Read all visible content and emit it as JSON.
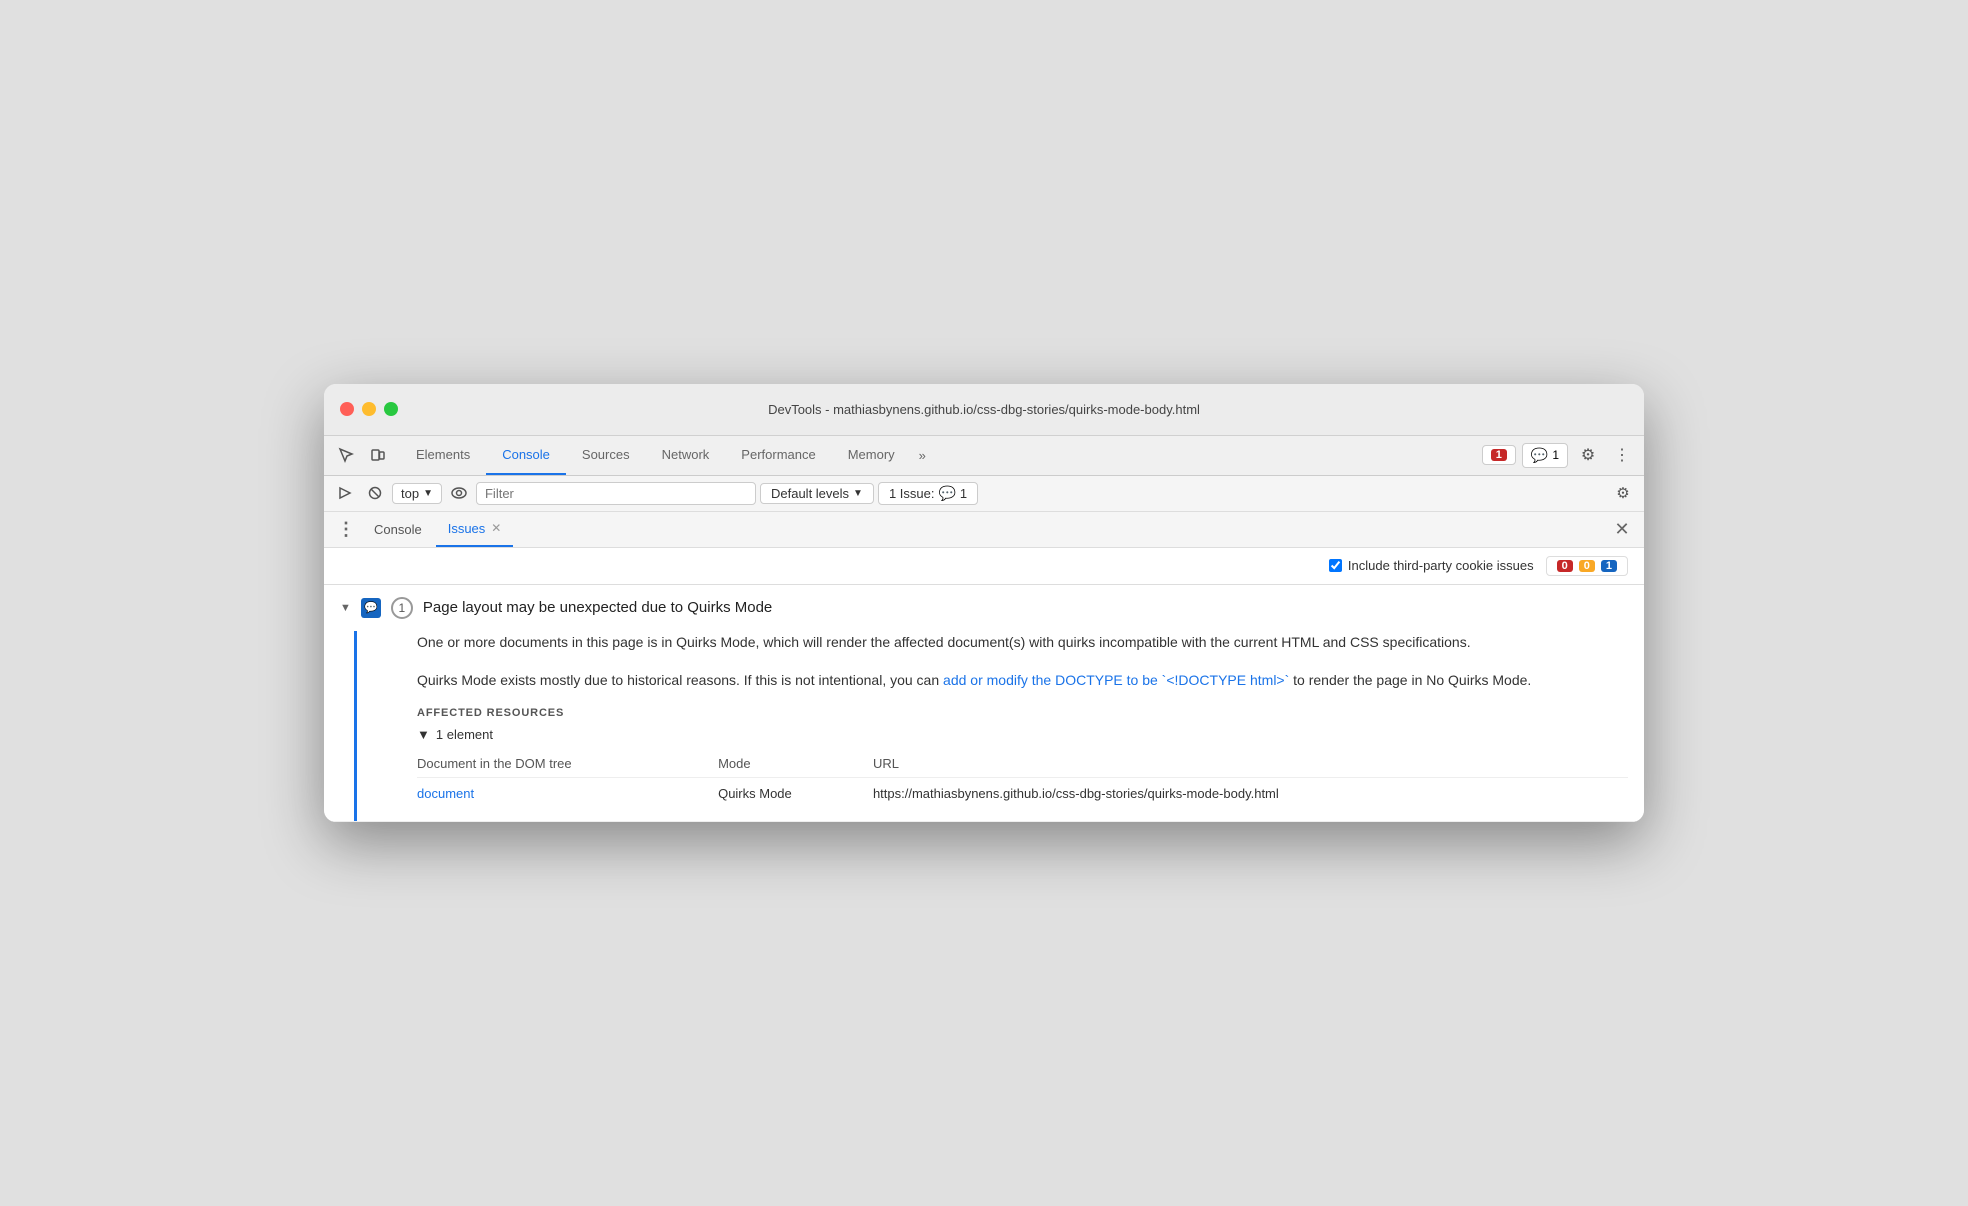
{
  "window": {
    "title": "DevTools - mathiasbynens.github.io/css-dbg-stories/quirks-mode-body.html"
  },
  "tabs": {
    "items": [
      {
        "label": "Elements",
        "active": false
      },
      {
        "label": "Console",
        "active": true
      },
      {
        "label": "Sources",
        "active": false
      },
      {
        "label": "Network",
        "active": false
      },
      {
        "label": "Performance",
        "active": false
      },
      {
        "label": "Memory",
        "active": false
      }
    ],
    "more_label": "»"
  },
  "toolbar_right": {
    "error_count": "1",
    "info_count": "1",
    "settings_label": "⚙",
    "more_label": "⋮"
  },
  "secondary_toolbar": {
    "context_label": "top",
    "filter_placeholder": "Filter",
    "levels_label": "Default levels",
    "issues_label": "1 Issue:",
    "issues_count": "1"
  },
  "panel_tabs": {
    "items": [
      {
        "label": "Console",
        "active": false,
        "closable": false
      },
      {
        "label": "Issues",
        "active": true,
        "closable": true
      }
    ],
    "close_label": "✕"
  },
  "issues_filter": {
    "checkbox_label": "Include third-party cookie issues",
    "counts": {
      "error": "0",
      "warn": "0",
      "info": "1"
    }
  },
  "issue": {
    "title": "Page layout may be unexpected due to Quirks Mode",
    "count": "1",
    "description_part1": "One or more documents in this page is in Quirks Mode, which will render the affected document(s) with quirks incompatible with the current HTML and CSS specifications.",
    "description_part2_before": "Quirks Mode exists mostly due to historical reasons. If this is not intentional, you can ",
    "description_link_text": "add or modify the DOCTYPE to be `<!DOCTYPE html>`",
    "description_part2_after": " to render the page in No Quirks Mode.",
    "affected_resources_label": "AFFECTED RESOURCES",
    "element_count_label": "1 element",
    "col_document": "Document in the DOM tree",
    "col_mode": "Mode",
    "col_url": "URL",
    "row_link": "document",
    "row_mode": "Quirks Mode",
    "row_url": "https://mathiasbynens.github.io/css-dbg-stories/quirks-mode-body.html"
  }
}
